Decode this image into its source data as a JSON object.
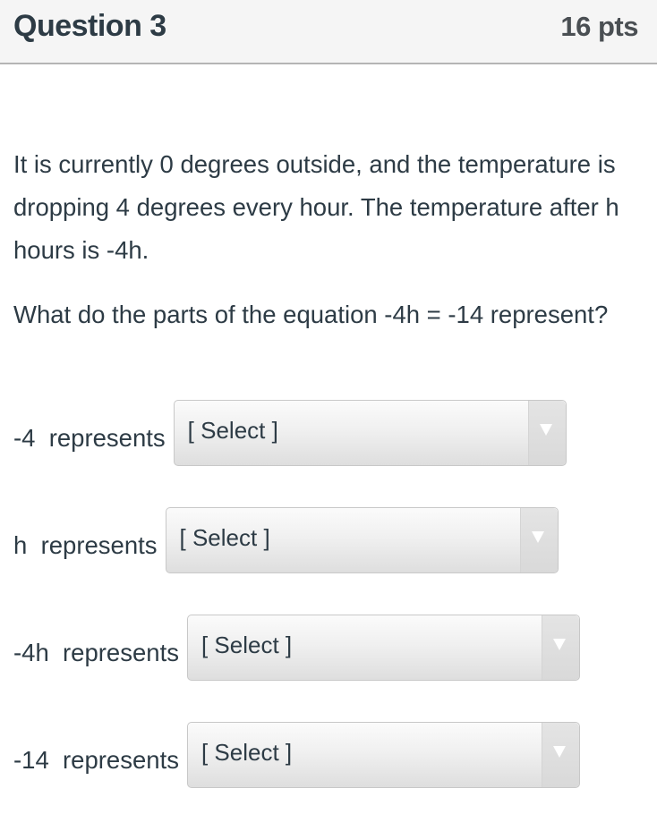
{
  "header": {
    "title": "Question 3",
    "points": "16 pts"
  },
  "question": {
    "paragraphs": [
      "It is currently 0 degrees outside, and the temperature is dropping 4 degrees every hour. The temperature after h hours is -4h.",
      "What do the parts of the equation -4h = -14 represent?"
    ]
  },
  "answers": [
    {
      "label": "-4  represents",
      "selected": "[ Select ]",
      "icon": "chevron-down-icon"
    },
    {
      "label": "h  represents",
      "selected": "[ Select ]",
      "icon": "chevron-down-icon"
    },
    {
      "label": "-4h  represents",
      "selected": "[ Select ]",
      "icon": "chevron-down-icon"
    },
    {
      "label": "-14  represents",
      "selected": "[ Select ]",
      "icon": "chevron-down-icon"
    }
  ]
}
